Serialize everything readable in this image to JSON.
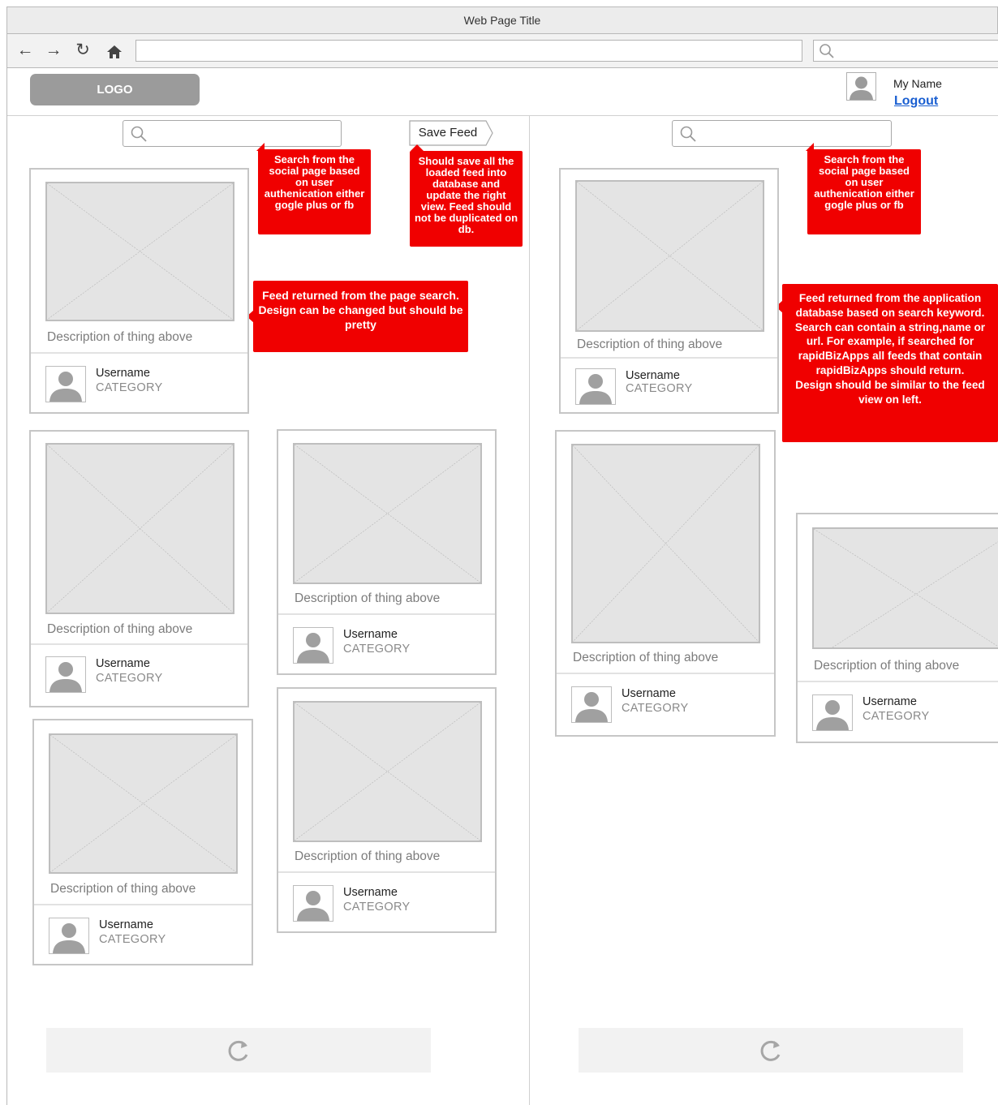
{
  "window": {
    "title": "Web Page Title"
  },
  "browser": {
    "back_icon": "arrow-left-icon",
    "forward_icon": "arrow-right-icon",
    "reload_icon": "reload-icon",
    "home_icon": "home-icon",
    "url": "",
    "search_value": ""
  },
  "header": {
    "logo": "LOGO",
    "user_name": "My Name",
    "logout": "Logout"
  },
  "left_panel": {
    "search_value": "",
    "save_feed": "Save Feed",
    "notes": {
      "search": "Search from the social page based on user authenication either gogle plus or fb",
      "save": "Should save all the loaded feed into database and update the right view. Feed should not be duplicated on db.",
      "feed": "Feed returned from the page search.\nDesign can be changed but should be pretty"
    },
    "cards": [
      {
        "description": "Description of thing above",
        "username": "Username",
        "category": "CATEGORY"
      },
      {
        "description": "Description of thing above",
        "username": "Username",
        "category": "CATEGORY"
      },
      {
        "description": "Description of thing above",
        "username": "Username",
        "category": "CATEGORY"
      },
      {
        "description": "Description of thing above",
        "username": "Username",
        "category": "CATEGORY"
      },
      {
        "description": "Description of thing above",
        "username": "Username",
        "category": "CATEGORY"
      }
    ]
  },
  "right_panel": {
    "search_value": "",
    "notes": {
      "search": "Search from the social page based on user authenication either gogle plus or fb",
      "feed": "Feed returned from the application database based on search keyword. Search can contain a string,name or url. For example, if searched for rapidBizApps all feeds that contain rapidBizApps should return.\nDesign should be similar to the feed view on left."
    },
    "cards": [
      {
        "description": "Description of thing above",
        "username": "Username",
        "category": "CATEGORY"
      },
      {
        "description": "Description of thing above",
        "username": "Username",
        "category": "CATEGORY"
      },
      {
        "description": "Description of thing above",
        "username": "Username",
        "category": "CATEGORY"
      }
    ]
  },
  "colors": {
    "annotation": "#f00000",
    "link": "#1a5fd1",
    "placeholder": "#e4e4e4"
  }
}
